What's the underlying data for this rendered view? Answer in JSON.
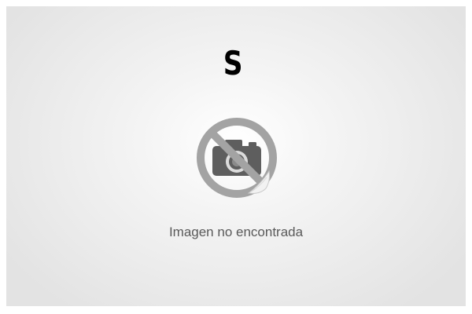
{
  "logo": {
    "letter": "S"
  },
  "placeholder": {
    "icon": "no-camera-icon",
    "message": "Imagen no encontrada"
  },
  "colors": {
    "frame_bg": "#e3e3e3",
    "icon_gray": "#9a9a9a",
    "icon_dark": "#5a5a5a",
    "text": "#595959"
  }
}
